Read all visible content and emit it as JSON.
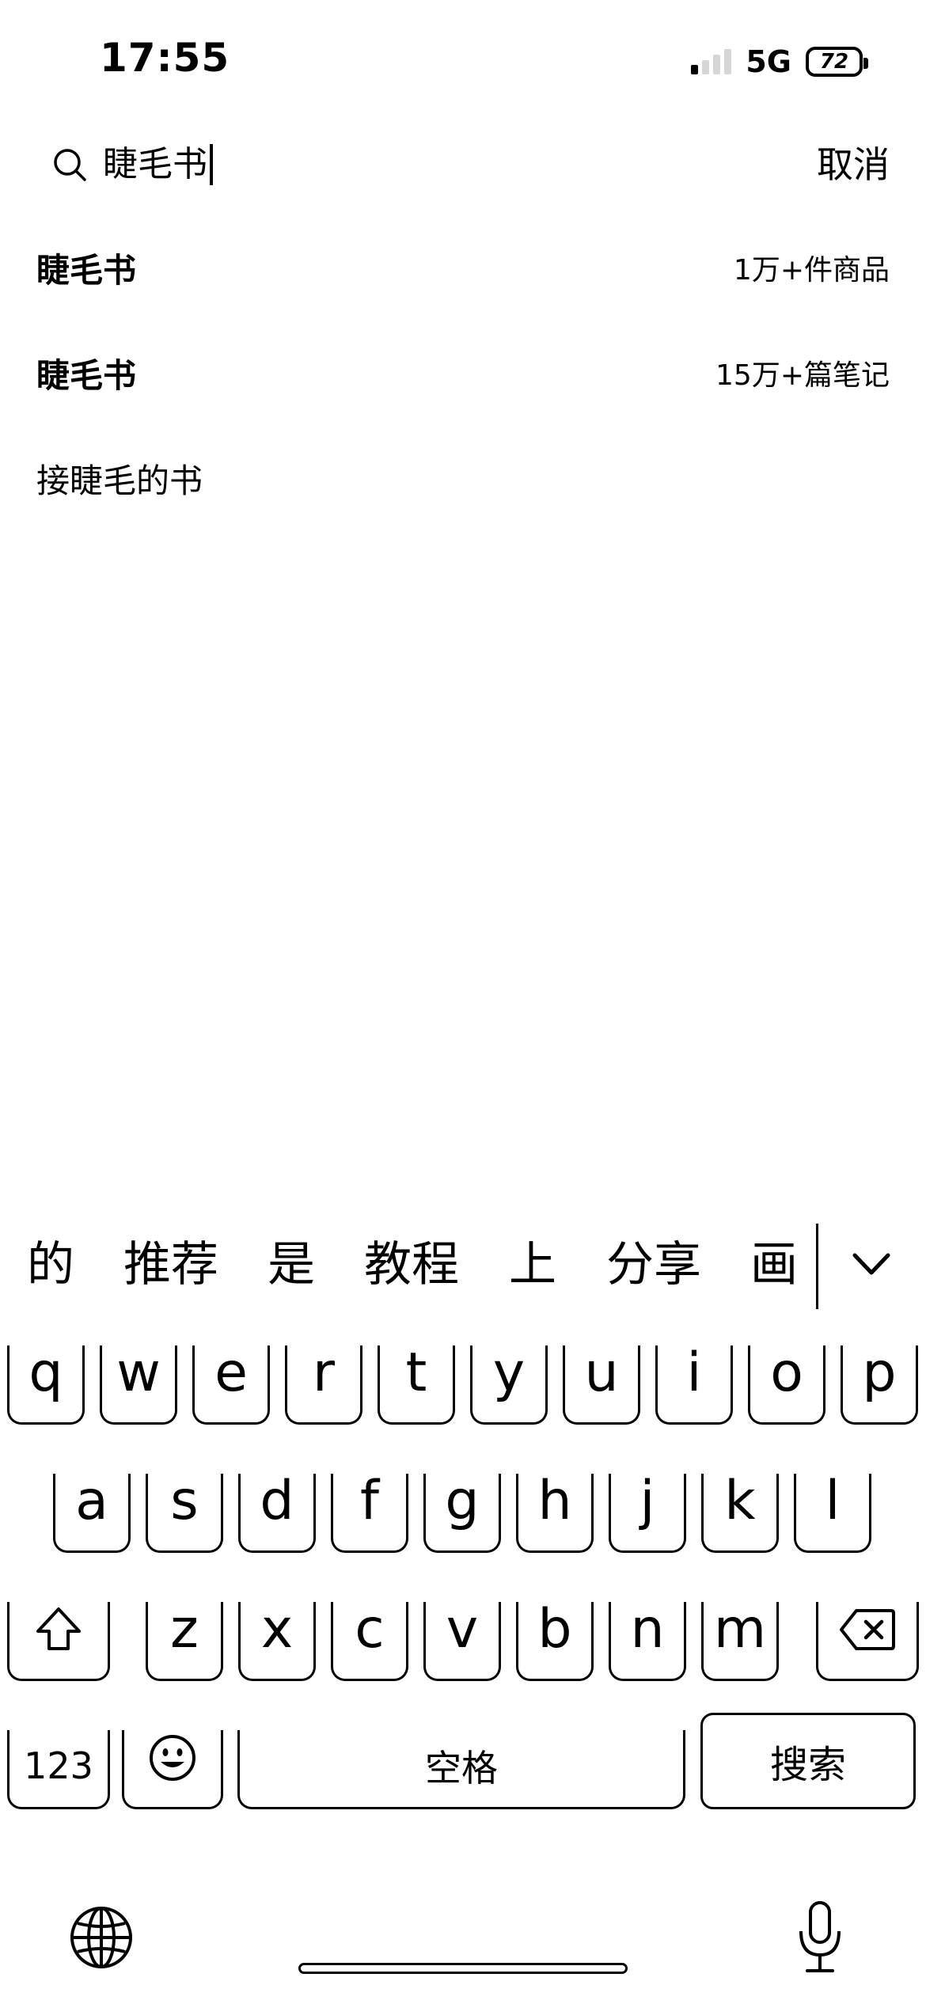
{
  "status_bar": {
    "time": "17:55",
    "network": "5G",
    "battery": "72",
    "signal_bars_active": 1,
    "signal_bars_total": 4
  },
  "search": {
    "query": "睫毛书",
    "cancel_label": "取消"
  },
  "suggestions": [
    {
      "title": "睫毛书",
      "count": "1万+件商品",
      "bold": true
    },
    {
      "title": "睫毛书",
      "count": "15万+篇笔记",
      "bold": true
    },
    {
      "title": "接睫毛的书",
      "count": "",
      "bold": false
    }
  ],
  "keyboard": {
    "candidates": [
      "的",
      "推荐",
      "是",
      "教程",
      "上",
      "分享",
      "画"
    ],
    "row1": [
      "q",
      "w",
      "e",
      "r",
      "t",
      "y",
      "u",
      "i",
      "o",
      "p"
    ],
    "row2": [
      "a",
      "s",
      "d",
      "f",
      "g",
      "h",
      "j",
      "k",
      "l"
    ],
    "row3": [
      "z",
      "x",
      "c",
      "v",
      "b",
      "n",
      "m"
    ],
    "numbers_label": "123",
    "space_label": "空格",
    "search_label": "搜索",
    "icons": {
      "shift": "shift-icon",
      "delete": "delete-icon",
      "emoji": "emoji-icon",
      "globe": "globe-icon",
      "mic": "microphone-icon",
      "collapse": "chevron-down-icon"
    }
  }
}
